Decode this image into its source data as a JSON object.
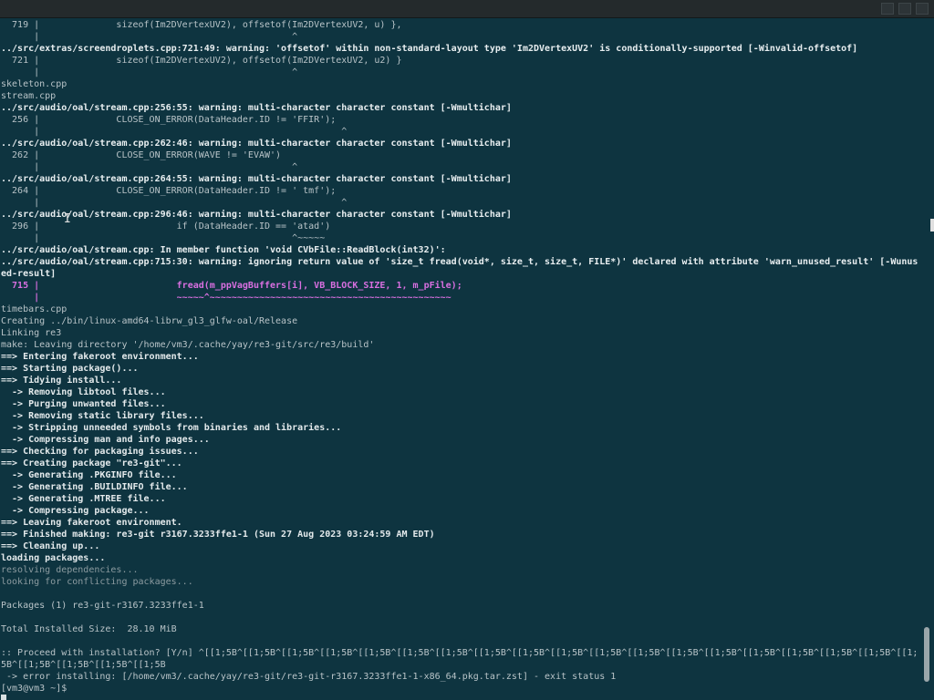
{
  "terminal": {
    "lines": [
      "  719 |              sizeof(Im2DVertexUV2), offsetof(Im2DVertexUV2, u) },",
      "      |                                              ^",
      "../src/extras/screendroplets.cpp:721:49: warning: 'offsetof' within non-standard-layout type 'Im2DVertexUV2' is conditionally-supported [-Winvalid-offsetof]",
      "  721 |              sizeof(Im2DVertexUV2), offsetof(Im2DVertexUV2, u2) }",
      "      |                                              ^",
      "skeleton.cpp",
      "stream.cpp",
      "../src/audio/oal/stream.cpp:256:55: warning: multi-character character constant [-Wmultichar]",
      "  256 |              CLOSE_ON_ERROR(DataHeader.ID != 'FFIR');",
      "      |                                                       ^",
      "../src/audio/oal/stream.cpp:262:46: warning: multi-character character constant [-Wmultichar]",
      "  262 |              CLOSE_ON_ERROR(WAVE != 'EVAW')",
      "      |                                              ^",
      "../src/audio/oal/stream.cpp:264:55: warning: multi-character character constant [-Wmultichar]",
      "  264 |              CLOSE_ON_ERROR(DataHeader.ID != ' tmf');",
      "      |                                                       ^",
      "../src/audio/oal/stream.cpp:296:46: warning: multi-character character constant [-Wmultichar]",
      "  296 |                         if (DataHeader.ID == 'atad')",
      "      |                                              ^~~~~~",
      "../src/audio/oal/stream.cpp: In member function 'void CVbFile::ReadBlock(int32)':",
      "../src/audio/oal/stream.cpp:715:30: warning: ignoring return value of 'size_t fread(void*, size_t, size_t, FILE*)' declared with attribute 'warn_unused_result' [-Wunus",
      "ed-result]",
      "  715 |                         fread(m_ppVagBuffers[i], VB_BLOCK_SIZE, 1, m_pFile);",
      "      |                         ~~~~~^~~~~~~~~~~~~~~~~~~~~~~~~~~~~~~~~~~~~~~~~~~~~",
      "timebars.cpp",
      "Creating ../bin/linux-amd64-librw_gl3_glfw-oal/Release",
      "Linking re3",
      "make: Leaving directory '/home/vm3/.cache/yay/re3-git/src/re3/build'",
      "==> Entering fakeroot environment...",
      "==> Starting package()...",
      "==> Tidying install...",
      "  -> Removing libtool files...",
      "  -> Purging unwanted files...",
      "  -> Removing static library files...",
      "  -> Stripping unneeded symbols from binaries and libraries...",
      "  -> Compressing man and info pages...",
      "==> Checking for packaging issues...",
      "==> Creating package \"re3-git\"...",
      "  -> Generating .PKGINFO file...",
      "  -> Generating .BUILDINFO file...",
      "  -> Generating .MTREE file...",
      "  -> Compressing package...",
      "==> Leaving fakeroot environment.",
      "==> Finished making: re3-git r3167.3233ffe1-1 (Sun 27 Aug 2023 03:24:59 AM EDT)",
      "==> Cleaning up...",
      "loading packages...",
      "resolving dependencies...",
      "looking for conflicting packages...",
      "",
      "Packages (1) re3-git-r3167.3233ffe1-1",
      "",
      "Total Installed Size:  28.10 MiB",
      "",
      ":: Proceed with installation? [Y/n] ^[[1;5B^[[1;5B^[[1;5B^[[1;5B^[[1;5B^[[1;5B^[[1;5B^[[1;5B^[[1;5B^[[1;5B^[[1;5B^[[1;5B^[[1;5B^[[1;5B^[[1;5B^[[1;5B^[[1;5B^[[1;5B^[[1;",
      "5B^[[1;5B^[[1;5B^[[1;5B^[[1;5B",
      " -> error installing: [/home/vm3/.cache/yay/re3-git/re3-git-r3167.3233ffe1-1-x86_64.pkg.tar.zst] - exit status 1",
      "[vm3@vm3 ~]$ "
    ]
  },
  "colors": {
    "background": "#0e3440",
    "warning": "#d86fe0",
    "arrow": "#3fd36a",
    "sub_arrow": "#5aa5e8"
  }
}
